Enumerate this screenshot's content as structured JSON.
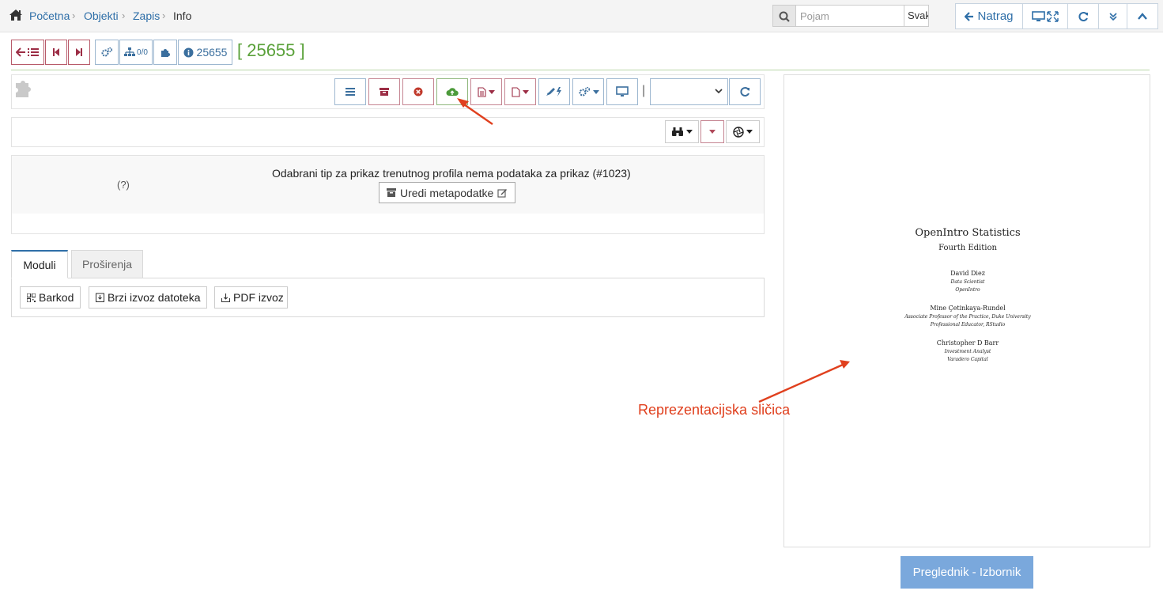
{
  "breadcrumb": {
    "items": [
      "Početna",
      "Objekti",
      "Zapis"
    ],
    "current": "Info"
  },
  "search": {
    "placeholder": "Pojam",
    "value": "",
    "scope": "Svako"
  },
  "nav": {
    "back_label": "Natrag"
  },
  "record": {
    "id_badge": "25655",
    "hierarchy_count": "0/0",
    "title": "[ 25655 ]"
  },
  "info": {
    "question_mark": "(?)",
    "message": "Odabrani tip za prikaz trenutnog profila nema podataka za prikaz (#1023)",
    "edit_button": "Uredi metapodatke"
  },
  "tabs": [
    {
      "label": "Moduli",
      "active": true
    },
    {
      "label": "Proširenja",
      "active": false
    }
  ],
  "modules": [
    {
      "label": "Barkod",
      "icon": "qrcode-icon"
    },
    {
      "label": "Brzi izvoz datoteka",
      "icon": "export-icon"
    },
    {
      "label": "PDF izvoz",
      "icon": "download-icon"
    }
  ],
  "preview": {
    "cover": {
      "title": "OpenIntro Statistics",
      "edition": "Fourth Edition",
      "authors": [
        {
          "name": "David Diez",
          "roles": [
            "Data Scientist",
            "OpenIntro"
          ]
        },
        {
          "name": "Mine Çetinkaya-Rundel",
          "roles": [
            "Associate Professor of the Practice, Duke University",
            "Professional Educator, RStudio"
          ]
        },
        {
          "name": "Christopher D Barr",
          "roles": [
            "Investment Analyst",
            "Varadero Capital"
          ]
        }
      ]
    },
    "button_label": "Preglednik - Izbornik"
  },
  "annotation": {
    "label": "Reprezentacijska sličica"
  },
  "colors": {
    "link": "#2f6fa8",
    "record_title": "#5aa13a",
    "annotation": "#e0401e",
    "preview_button": "#7aa8dc"
  }
}
